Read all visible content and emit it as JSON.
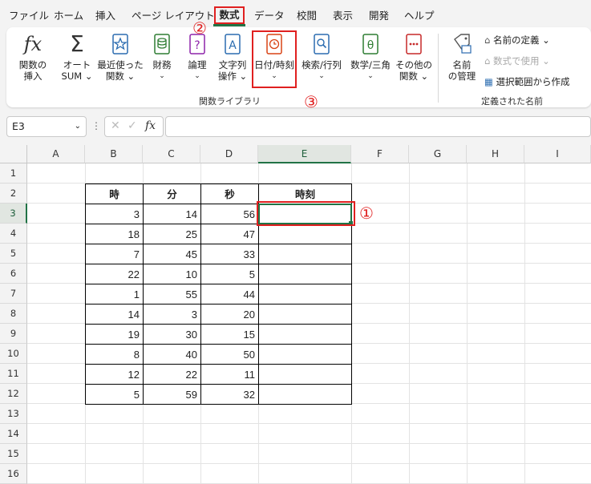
{
  "menu": {
    "tabs": [
      "ファイル",
      "ホーム",
      "挿入",
      "ページ レイアウト",
      "数式",
      "データ",
      "校閲",
      "表示",
      "開発",
      "ヘルプ"
    ],
    "active_tab": "数式"
  },
  "ribbon": {
    "function_library": {
      "buttons": [
        {
          "line1": "関数の",
          "line2": "挿入"
        },
        {
          "line1": "オート",
          "line2": "SUM ⌄"
        },
        {
          "line1": "最近使った",
          "line2": "関数 ⌄"
        },
        {
          "line1": "財務",
          "line2": "⌄"
        },
        {
          "line1": "論理",
          "line2": "⌄"
        },
        {
          "line1": "文字列",
          "line2": "操作 ⌄"
        },
        {
          "line1": "日付/時刻",
          "line2": "⌄"
        },
        {
          "line1": "検索/行列",
          "line2": "⌄"
        },
        {
          "line1": "数学/三角",
          "line2": "⌄"
        },
        {
          "line1": "その他の",
          "line2": "関数 ⌄"
        }
      ],
      "group_label": "関数ライブラリ"
    },
    "defined_names": {
      "name_manager_line1": "名前",
      "name_manager_line2": "の管理",
      "define_name": "名前の定義 ⌄",
      "use_in_formula": "数式で使用 ⌄",
      "create_from_selection": "選択範囲から作成",
      "group_label": "定義された名前"
    },
    "fx_symbol": "fx",
    "sigma_symbol": "Σ"
  },
  "formula_bar": {
    "name_box": "E3",
    "cancel": "✕",
    "enter": "✓",
    "fx": "fx",
    "content": ""
  },
  "sheet": {
    "columns": [
      "A",
      "B",
      "C",
      "D",
      "E",
      "F",
      "G",
      "H",
      "I"
    ],
    "rows": [
      "1",
      "2",
      "3",
      "4",
      "5",
      "6",
      "7",
      "8",
      "9",
      "10",
      "11",
      "12",
      "13",
      "14",
      "15",
      "16"
    ],
    "selected_cell": "E3",
    "table": {
      "headers": [
        "時",
        "分",
        "秒",
        "時刻"
      ],
      "rows": [
        [
          "3",
          "14",
          "56",
          ""
        ],
        [
          "18",
          "25",
          "47",
          ""
        ],
        [
          "7",
          "45",
          "33",
          ""
        ],
        [
          "22",
          "10",
          "5",
          ""
        ],
        [
          "1",
          "55",
          "44",
          ""
        ],
        [
          "14",
          "3",
          "20",
          ""
        ],
        [
          "19",
          "30",
          "15",
          ""
        ],
        [
          "8",
          "40",
          "50",
          ""
        ],
        [
          "12",
          "22",
          "11",
          ""
        ],
        [
          "5",
          "59",
          "32",
          ""
        ]
      ]
    }
  },
  "callouts": {
    "one": "①",
    "two": "②",
    "three": "③"
  },
  "colors": {
    "highlight": "#e02020",
    "excel_green": "#217346"
  }
}
